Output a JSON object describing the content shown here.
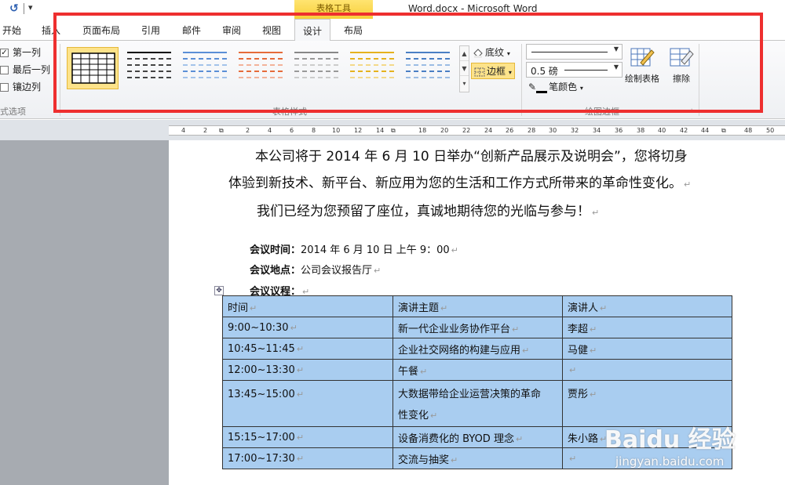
{
  "window": {
    "title": "Word.docx - Microsoft Word",
    "context_tab_header": "表格工具"
  },
  "qat": {
    "undo_icon": "undo-icon",
    "more_icon": "customize-qat-icon"
  },
  "tabs": [
    {
      "label": "开始"
    },
    {
      "label": "插入"
    },
    {
      "label": "页面布局"
    },
    {
      "label": "引用"
    },
    {
      "label": "邮件"
    },
    {
      "label": "审阅"
    },
    {
      "label": "视图"
    },
    {
      "label": "设计"
    },
    {
      "label": "布局"
    }
  ],
  "ribbon": {
    "style_options": {
      "items": [
        {
          "label": "第一列",
          "checked": true
        },
        {
          "label": "最后一列",
          "checked": false
        },
        {
          "label": "镶边列",
          "checked": false
        }
      ],
      "group_label": "式选项"
    },
    "table_styles": {
      "group_label": "表格样式",
      "shading_label": "底纹",
      "borders_label": "边框"
    },
    "draw_borders": {
      "group_label": "绘图边框",
      "line_weight": "0.5 磅",
      "pen_color_label": "笔颜色",
      "draw_table_label": "绘制表格",
      "eraser_label": "擦除"
    }
  },
  "ruler": {
    "ticks": [
      "4",
      "2",
      "",
      "2",
      "4",
      "6",
      "8",
      "10",
      "12",
      "14",
      "",
      "18",
      "20",
      "22",
      "24",
      "26",
      "28",
      "30",
      "32",
      "34",
      "36",
      "38",
      "40",
      "42",
      "44",
      "",
      "48",
      "50"
    ]
  },
  "document": {
    "para1_line1": "本公司将于 2014 年 6 月 10 日举办“创新产品展示及说明会”，您将切身",
    "para1_line2": "体验到新技术、新平台、新应用为您的生活和工作方式所带来的革命性变化。",
    "para2": "我们已经为您预留了座位，真诚地期待您的光临与参与！",
    "meeting_time_label": "会议时间：",
    "meeting_time_value": "2014 年 6 月 10 日 上午 9：00",
    "meeting_place_label": "会议地点：",
    "meeting_place_value": "公司会议报告厅",
    "agenda_label": "会议议程：",
    "paragraph_mark": "↵",
    "table": {
      "header": [
        "时间",
        "演讲主题",
        "演讲人"
      ],
      "rows": [
        [
          "9:00~10:30",
          "新一代企业业务协作平台",
          "李超"
        ],
        [
          "10:45~11:45",
          "企业社交网络的构建与应用",
          "马健"
        ],
        [
          "12:00~13:30",
          "午餐",
          ""
        ],
        [
          "13:45~15:00",
          "大数据带给企业运营决策的革命性变化",
          "贾彤"
        ],
        [
          "15:15~17:00",
          "设备消费化的 BYOD 理念",
          "朱小路"
        ],
        [
          "17:00~17:30",
          "交流与抽奖",
          ""
        ]
      ],
      "row4_topic_line1": "大数据带给企业运营决策的革命",
      "row4_topic_line2": "性变化"
    }
  },
  "watermark": {
    "logo": "Baidu 经验",
    "url": "jingyan.baidu.com"
  },
  "colors": {
    "accent_highlight": "#ee2f2f",
    "table_shading": "#a9cdf0",
    "selected_style": "#fde38a"
  }
}
